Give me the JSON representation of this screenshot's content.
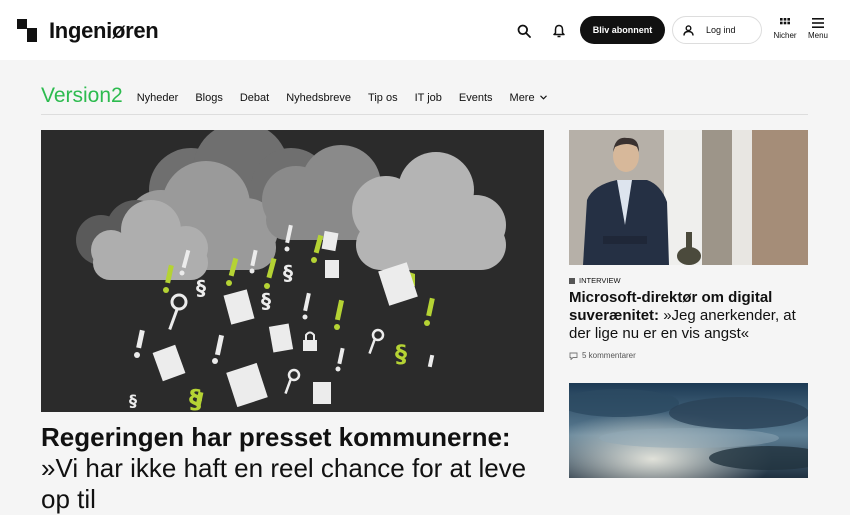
{
  "header": {
    "logo_text": "Ingeniøren",
    "subscribe_label": "Bliv abonnent",
    "login_label": "Log ind",
    "nicher_label": "Nicher",
    "menu_label": "Menu",
    "icons": [
      "search-icon",
      "bell-icon",
      "user-icon",
      "grid-icon",
      "hamburger-icon"
    ]
  },
  "section_nav": {
    "brand": "Version2",
    "items": [
      "Nyheder",
      "Blogs",
      "Debat",
      "Nyhedsbreve",
      "Tip os",
      "IT job",
      "Events"
    ],
    "more_label": "Mere"
  },
  "hero": {
    "title_bold": "Regeringen har presset kommunerne:",
    "title_rest": " »Vi har ikke haft en reel chance for at leve op til"
  },
  "side_article": {
    "kicker": "INTERVIEW",
    "title_bold": "Microsoft-direktør om digital suverænitet:",
    "title_rest": " »Jeg anerkender, at der lige nu er en vis angst«",
    "comments": "5 kommentarer"
  },
  "colors": {
    "brand_green": "#2dbb4f",
    "accent_lime": "#b5d334"
  }
}
